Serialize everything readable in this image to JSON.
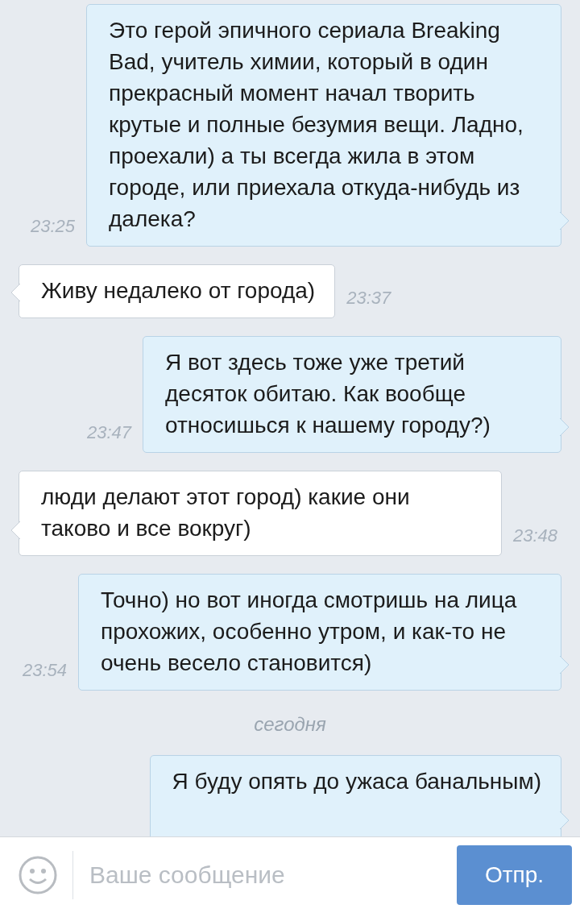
{
  "messages": [
    {
      "kind": "sent",
      "text": "Это герой эпичного сериала Breaking Bad, учитель химии, который в один прекрасный момент начал творить крутые и полные безумия вещи. Ладно, проехали) а ты всегда жила в этом городе, или приехала откуда-нибудь из далека?",
      "time": "23:25"
    },
    {
      "kind": "received",
      "text": "Живу недалеко от города)",
      "time": "23:37"
    },
    {
      "kind": "sent",
      "text": "Я вот здесь тоже уже третий десяток обитаю. Как вообще относишься к нашему городу?)",
      "time": "23:47"
    },
    {
      "kind": "received",
      "text": "люди делают этот город) какие они таково и все вокруг)",
      "time": "23:48"
    },
    {
      "kind": "sent",
      "text": "Точно) но вот иногда смотришь на лица прохожих, особенно утром, и как-то не очень весело становится)",
      "time": "23:54"
    },
    {
      "kind": "date",
      "text": "сегодня"
    },
    {
      "kind": "sent",
      "text": "Я буду опять до ужаса банальным)"
    }
  ],
  "composer": {
    "placeholder": "Ваше сообщение",
    "send": "Отпр."
  }
}
